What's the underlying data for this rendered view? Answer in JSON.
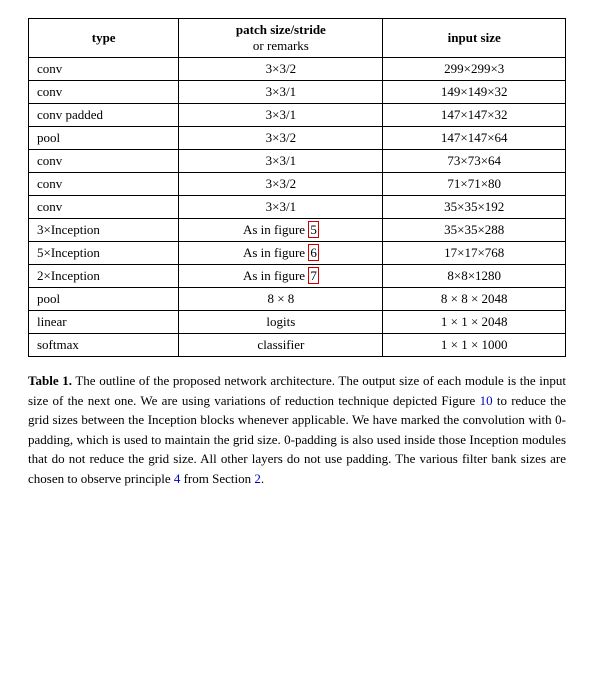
{
  "table": {
    "headers": {
      "col1": "type",
      "col2_main": "patch size/stride",
      "col2_sub": "or remarks",
      "col3": "input size"
    },
    "rows": [
      {
        "type": "conv",
        "patch": "3×3/2",
        "input": "299×299×3"
      },
      {
        "type": "conv",
        "patch": "3×3/1",
        "input": "149×149×32"
      },
      {
        "type": "conv padded",
        "patch": "3×3/1",
        "input": "147×147×32"
      },
      {
        "type": "pool",
        "patch": "3×3/2",
        "input": "147×147×64"
      },
      {
        "type": "conv",
        "patch": "3×3/1",
        "input": "73×73×64"
      },
      {
        "type": "conv",
        "patch": "3×3/2",
        "input": "71×71×80"
      },
      {
        "type": "conv",
        "patch": "3×3/1",
        "input": "35×35×192"
      },
      {
        "type": "3×Inception",
        "patch": "As in figure 5",
        "input": "35×35×288",
        "highlight": "5"
      },
      {
        "type": "5×Inception",
        "patch": "As in figure 6",
        "input": "17×17×768",
        "highlight": "6"
      },
      {
        "type": "2×Inception",
        "patch": "As in figure 7",
        "input": "8×8×1280",
        "highlight": "7"
      },
      {
        "type": "pool",
        "patch": "8 × 8",
        "input": "8 × 8 × 2048"
      },
      {
        "type": "linear",
        "patch": "logits",
        "input": "1 × 1 × 2048"
      },
      {
        "type": "softmax",
        "patch": "classifier",
        "input": "1 × 1 × 1000"
      }
    ]
  },
  "caption": {
    "title": "Table 1.",
    "body": " The outline of the proposed network architecture.  The output size of each module is the input size of the next one.  We are using variations of reduction technique depicted Figure ",
    "link1_text": "10",
    "middle1": " to reduce the grid sizes between the Inception blocks whenever applicable. We have marked the convolution with 0-padding, which is used to maintain the grid size.  0-padding is also used inside those Inception modules that do not reduce the grid size. All other layers do not use padding. The various filter bank sizes are chosen to observe principle ",
    "link2_text": "4",
    "middle2": " from Section ",
    "link3_text": "2",
    "end": "."
  }
}
